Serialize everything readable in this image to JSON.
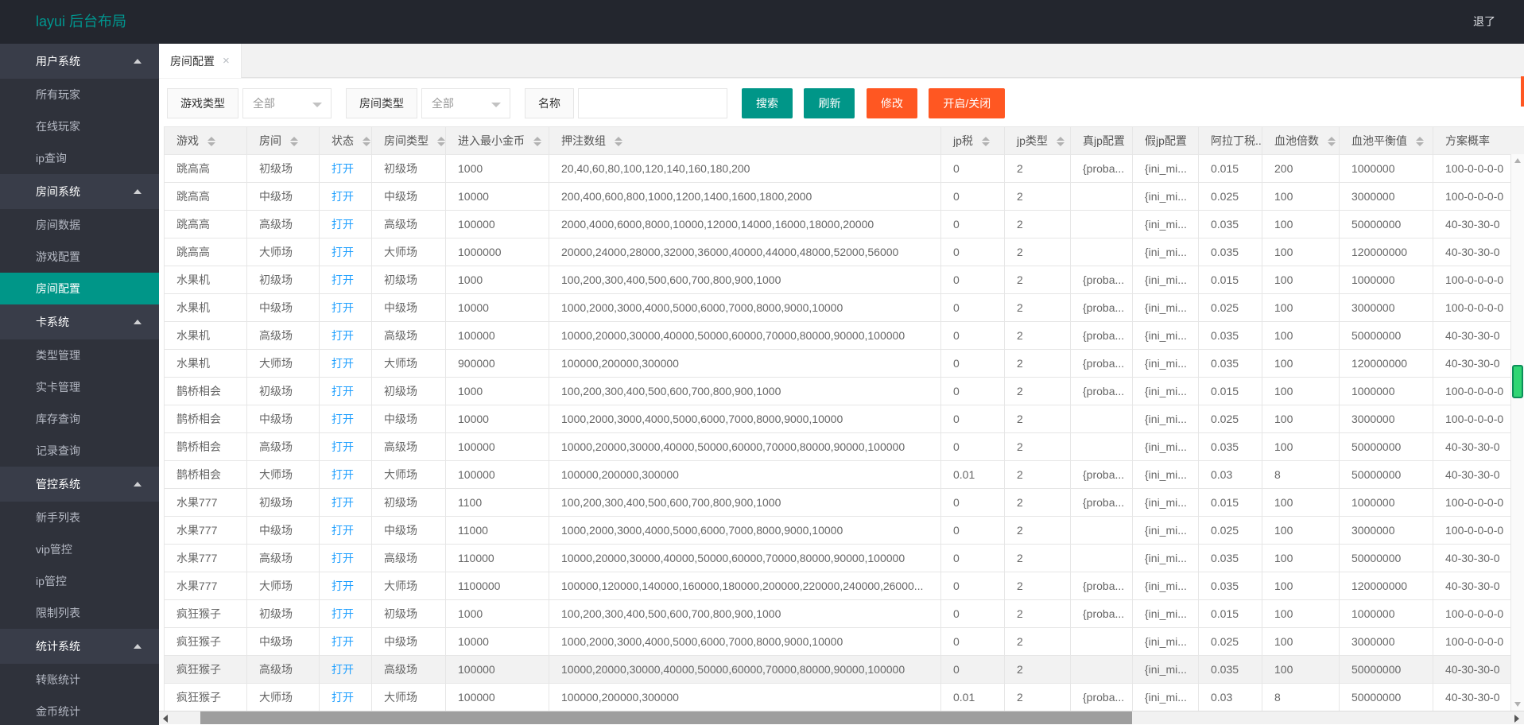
{
  "header": {
    "logo": "layui 后台布局",
    "logout": "退了"
  },
  "sidebar": {
    "items": [
      {
        "label": "用户系统",
        "type": "group",
        "active": "false"
      },
      {
        "label": "所有玩家",
        "type": "item",
        "active": "false"
      },
      {
        "label": "在线玩家",
        "type": "item",
        "active": "false"
      },
      {
        "label": "ip查询",
        "type": "item",
        "active": "false"
      },
      {
        "label": "房间系统",
        "type": "group",
        "active": "false"
      },
      {
        "label": "房间数据",
        "type": "item",
        "active": "false"
      },
      {
        "label": "游戏配置",
        "type": "item",
        "active": "false"
      },
      {
        "label": "房间配置",
        "type": "item",
        "active": "true"
      },
      {
        "label": "卡系统",
        "type": "group",
        "active": "false"
      },
      {
        "label": "类型管理",
        "type": "item",
        "active": "false"
      },
      {
        "label": "实卡管理",
        "type": "item",
        "active": "false"
      },
      {
        "label": "库存查询",
        "type": "item",
        "active": "false"
      },
      {
        "label": "记录查询",
        "type": "item",
        "active": "false"
      },
      {
        "label": "管控系统",
        "type": "group",
        "active": "false"
      },
      {
        "label": "新手列表",
        "type": "item",
        "active": "false"
      },
      {
        "label": "vip管控",
        "type": "item",
        "active": "false"
      },
      {
        "label": "ip管控",
        "type": "item",
        "active": "false"
      },
      {
        "label": "限制列表",
        "type": "item",
        "active": "false"
      },
      {
        "label": "统计系统",
        "type": "group",
        "active": "false"
      },
      {
        "label": "转账统计",
        "type": "item",
        "active": "false"
      },
      {
        "label": "金币统计",
        "type": "item",
        "active": "false"
      }
    ]
  },
  "tab": {
    "label": "房间配置",
    "close_icon": "×"
  },
  "filter": {
    "game_type_label": "游戏类型",
    "game_type_value": "全部",
    "room_type_label": "房间类型",
    "room_type_value": "全部",
    "name_label": "名称",
    "name_value": ""
  },
  "toolbar": {
    "buttons": [
      {
        "label": "搜索",
        "color": "teal"
      },
      {
        "label": "刷新",
        "color": "teal"
      },
      {
        "label": "修改",
        "color": "orange"
      },
      {
        "label": "开启/关闭",
        "color": "orange"
      }
    ]
  },
  "colors": {
    "accent_teal": "#009688",
    "accent_orange": "#FF5722",
    "link_blue": "#1E9FFF",
    "active_nav": "#009688"
  },
  "table": {
    "columns": [
      {
        "label": "游戏",
        "sortable": "true"
      },
      {
        "label": "房间",
        "sortable": "true"
      },
      {
        "label": "状态",
        "sortable": "true"
      },
      {
        "label": "房间类型",
        "sortable": "true"
      },
      {
        "label": "进入最小金币",
        "sortable": "true"
      },
      {
        "label": "押注数组",
        "sortable": "true"
      },
      {
        "label": "jp税",
        "sortable": "true"
      },
      {
        "label": "jp类型",
        "sortable": "true"
      },
      {
        "label": "真jp配置",
        "sortable": "false"
      },
      {
        "label": "假jp配置",
        "sortable": "false"
      },
      {
        "label": "阿拉丁税..",
        "sortable": "true"
      },
      {
        "label": "血池倍数",
        "sortable": "true"
      },
      {
        "label": "血池平衡值",
        "sortable": "true"
      },
      {
        "label": "方案概率",
        "sortable": "false"
      }
    ],
    "rows": [
      {
        "hl": "false",
        "cells": [
          "跳高高",
          "初级场",
          "打开",
          "初级场",
          "1000",
          "20,40,60,80,100,120,140,160,180,200",
          "0",
          "2",
          "{proba...",
          "{ini_mi...",
          "0.015",
          "200",
          "1000000",
          "100-0-0-0-0"
        ]
      },
      {
        "hl": "false",
        "cells": [
          "跳高高",
          "中级场",
          "打开",
          "中级场",
          "10000",
          "200,400,600,800,1000,1200,1400,1600,1800,2000",
          "0",
          "2",
          "",
          "{ini_mi...",
          "0.025",
          "100",
          "3000000",
          "100-0-0-0-0"
        ]
      },
      {
        "hl": "false",
        "cells": [
          "跳高高",
          "高级场",
          "打开",
          "高级场",
          "100000",
          "2000,4000,6000,8000,10000,12000,14000,16000,18000,20000",
          "0",
          "2",
          "",
          "{ini_mi...",
          "0.035",
          "100",
          "50000000",
          "40-30-30-0"
        ]
      },
      {
        "hl": "false",
        "cells": [
          "跳高高",
          "大师场",
          "打开",
          "大师场",
          "1000000",
          "20000,24000,28000,32000,36000,40000,44000,48000,52000,56000",
          "0",
          "2",
          "",
          "{ini_mi...",
          "0.035",
          "100",
          "120000000",
          "40-30-30-0"
        ]
      },
      {
        "hl": "false",
        "cells": [
          "水果机",
          "初级场",
          "打开",
          "初级场",
          "1000",
          "100,200,300,400,500,600,700,800,900,1000",
          "0",
          "2",
          "{proba...",
          "{ini_mi...",
          "0.015",
          "100",
          "1000000",
          "100-0-0-0-0"
        ]
      },
      {
        "hl": "false",
        "cells": [
          "水果机",
          "中级场",
          "打开",
          "中级场",
          "10000",
          "1000,2000,3000,4000,5000,6000,7000,8000,9000,10000",
          "0",
          "2",
          "{proba...",
          "{ini_mi...",
          "0.025",
          "100",
          "3000000",
          "100-0-0-0-0"
        ]
      },
      {
        "hl": "false",
        "cells": [
          "水果机",
          "高级场",
          "打开",
          "高级场",
          "100000",
          "10000,20000,30000,40000,50000,60000,70000,80000,90000,100000",
          "0",
          "2",
          "{proba...",
          "{ini_mi...",
          "0.035",
          "100",
          "50000000",
          "40-30-30-0"
        ]
      },
      {
        "hl": "false",
        "cells": [
          "水果机",
          "大师场",
          "打开",
          "大师场",
          "900000",
          "100000,200000,300000",
          "0",
          "2",
          "{proba...",
          "{ini_mi...",
          "0.035",
          "100",
          "120000000",
          "40-30-30-0"
        ]
      },
      {
        "hl": "false",
        "cells": [
          "鹊桥相会",
          "初级场",
          "打开",
          "初级场",
          "1000",
          "100,200,300,400,500,600,700,800,900,1000",
          "0",
          "2",
          "{proba...",
          "{ini_mi...",
          "0.015",
          "100",
          "1000000",
          "100-0-0-0-0"
        ]
      },
      {
        "hl": "false",
        "cells": [
          "鹊桥相会",
          "中级场",
          "打开",
          "中级场",
          "10000",
          "1000,2000,3000,4000,5000,6000,7000,8000,9000,10000",
          "0",
          "2",
          "",
          "{ini_mi...",
          "0.025",
          "100",
          "3000000",
          "100-0-0-0-0"
        ]
      },
      {
        "hl": "false",
        "cells": [
          "鹊桥相会",
          "高级场",
          "打开",
          "高级场",
          "100000",
          "10000,20000,30000,40000,50000,60000,70000,80000,90000,100000",
          "0",
          "2",
          "",
          "{ini_mi...",
          "0.035",
          "100",
          "50000000",
          "40-30-30-0"
        ]
      },
      {
        "hl": "false",
        "cells": [
          "鹊桥相会",
          "大师场",
          "打开",
          "大师场",
          "100000",
          "100000,200000,300000",
          "0.01",
          "2",
          "{proba...",
          "{ini_mi...",
          "0.03",
          "8",
          "50000000",
          "40-30-30-0"
        ]
      },
      {
        "hl": "false",
        "cells": [
          "水果777",
          "初级场",
          "打开",
          "初级场",
          "1100",
          "100,200,300,400,500,600,700,800,900,1000",
          "0",
          "2",
          "{proba...",
          "{ini_mi...",
          "0.015",
          "100",
          "1000000",
          "100-0-0-0-0"
        ]
      },
      {
        "hl": "false",
        "cells": [
          "水果777",
          "中级场",
          "打开",
          "中级场",
          "11000",
          "1000,2000,3000,4000,5000,6000,7000,8000,9000,10000",
          "0",
          "2",
          "",
          "{ini_mi...",
          "0.025",
          "100",
          "3000000",
          "100-0-0-0-0"
        ]
      },
      {
        "hl": "false",
        "cells": [
          "水果777",
          "高级场",
          "打开",
          "高级场",
          "110000",
          "10000,20000,30000,40000,50000,60000,70000,80000,90000,100000",
          "0",
          "2",
          "",
          "{ini_mi...",
          "0.035",
          "100",
          "50000000",
          "40-30-30-0"
        ]
      },
      {
        "hl": "false",
        "cells": [
          "水果777",
          "大师场",
          "打开",
          "大师场",
          "1100000",
          "100000,120000,140000,160000,180000,200000,220000,240000,26000...",
          "0",
          "2",
          "{proba...",
          "{ini_mi...",
          "0.035",
          "100",
          "120000000",
          "40-30-30-0"
        ]
      },
      {
        "hl": "false",
        "cells": [
          "疯狂猴子",
          "初级场",
          "打开",
          "初级场",
          "1000",
          "100,200,300,400,500,600,700,800,900,1000",
          "0",
          "2",
          "{proba...",
          "{ini_mi...",
          "0.015",
          "100",
          "1000000",
          "100-0-0-0-0"
        ]
      },
      {
        "hl": "false",
        "cells": [
          "疯狂猴子",
          "中级场",
          "打开",
          "中级场",
          "10000",
          "1000,2000,3000,4000,5000,6000,7000,8000,9000,10000",
          "0",
          "2",
          "",
          "{ini_mi...",
          "0.025",
          "100",
          "3000000",
          "100-0-0-0-0"
        ]
      },
      {
        "hl": "true",
        "cells": [
          "疯狂猴子",
          "高级场",
          "打开",
          "高级场",
          "100000",
          "10000,20000,30000,40000,50000,60000,70000,80000,90000,100000",
          "0",
          "2",
          "",
          "{ini_mi...",
          "0.035",
          "100",
          "50000000",
          "40-30-30-0"
        ]
      },
      {
        "hl": "false",
        "cells": [
          "疯狂猴子",
          "大师场",
          "打开",
          "大师场",
          "100000",
          "100000,200000,300000",
          "0.01",
          "2",
          "{proba...",
          "{ini_mi...",
          "0.03",
          "8",
          "50000000",
          "40-30-30-0"
        ]
      }
    ]
  }
}
